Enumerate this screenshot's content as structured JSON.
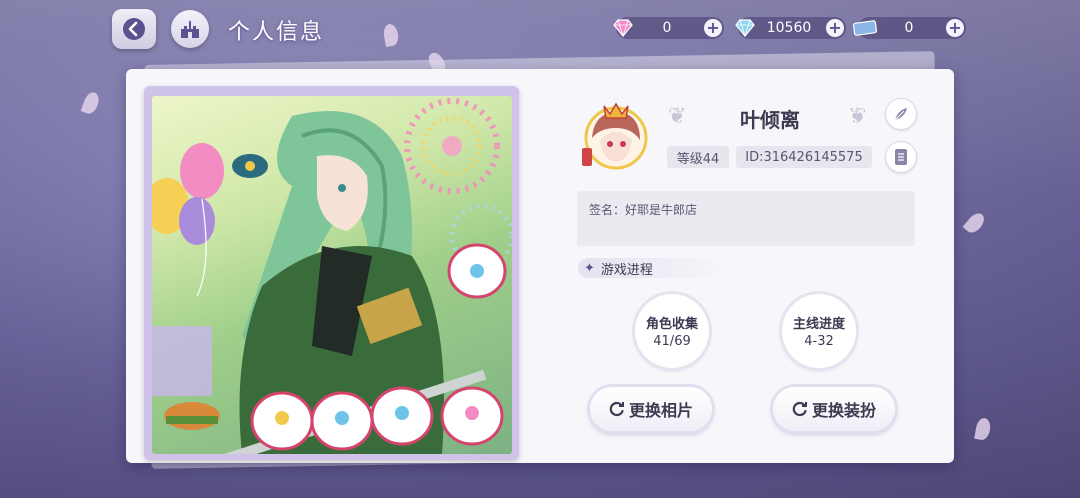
{
  "header": {
    "title": "个人信息"
  },
  "currencies": [
    {
      "icon": "pink-gem-icon",
      "value": "0",
      "color": "#f28bc9"
    },
    {
      "icon": "diamond-icon",
      "value": "10560",
      "color": "#8fd6f2"
    },
    {
      "icon": "ticket-icon",
      "value": "0",
      "color": "#8db6e8"
    }
  ],
  "profile": {
    "name": "叶倾离",
    "level": "等级44",
    "id": "ID:316426145575",
    "signature": "签名：好耶是牛郎店"
  },
  "progress": {
    "heading": "游戏进程",
    "character_collection": {
      "label": "角色收集",
      "value": "41/69"
    },
    "main_story": {
      "label": "主线进度",
      "value": "4-32"
    }
  },
  "actions": {
    "change_photo": "更换相片",
    "change_outfit": "更换装扮"
  },
  "colors": {
    "accent": "#5b5390",
    "text": "#3e3a52",
    "card": "#f7f7fb"
  }
}
